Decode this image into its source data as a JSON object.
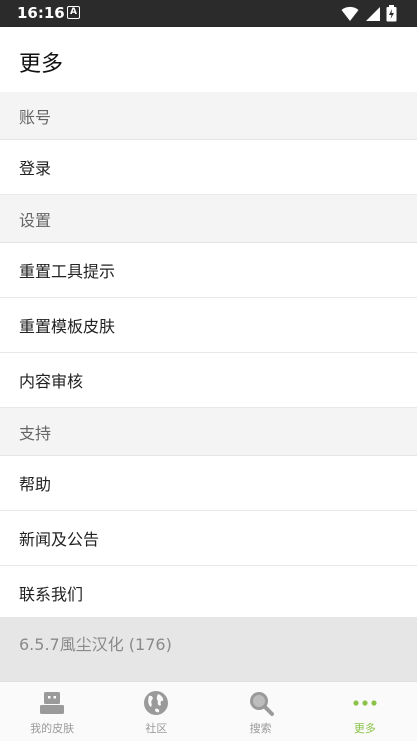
{
  "status_bar": {
    "time": "16:16",
    "badge": "A"
  },
  "app_bar": {
    "title": "更多"
  },
  "sections": [
    {
      "header": "账号",
      "items": [
        "登录"
      ]
    },
    {
      "header": "设置",
      "items": [
        "重置工具提示",
        "重置模板皮肤",
        "内容审核"
      ]
    },
    {
      "header": "支持",
      "items": [
        "帮助",
        "新闻及公告",
        "联系我们"
      ]
    }
  ],
  "version_text": "6.5.7風尘汉化 (176)",
  "bottom_nav": [
    {
      "label": "我的皮肤",
      "icon": "robot-skin-icon",
      "active": false
    },
    {
      "label": "社区",
      "icon": "globe-icon",
      "active": false
    },
    {
      "label": "搜索",
      "icon": "search-icon",
      "active": false
    },
    {
      "label": "更多",
      "icon": "more-dots-icon",
      "active": true
    }
  ],
  "colors": {
    "accent": "#8bc34a",
    "status_bar": "#2b2b2b",
    "section_bg": "#f4f4f4",
    "version_bg": "#e6e6e6"
  }
}
